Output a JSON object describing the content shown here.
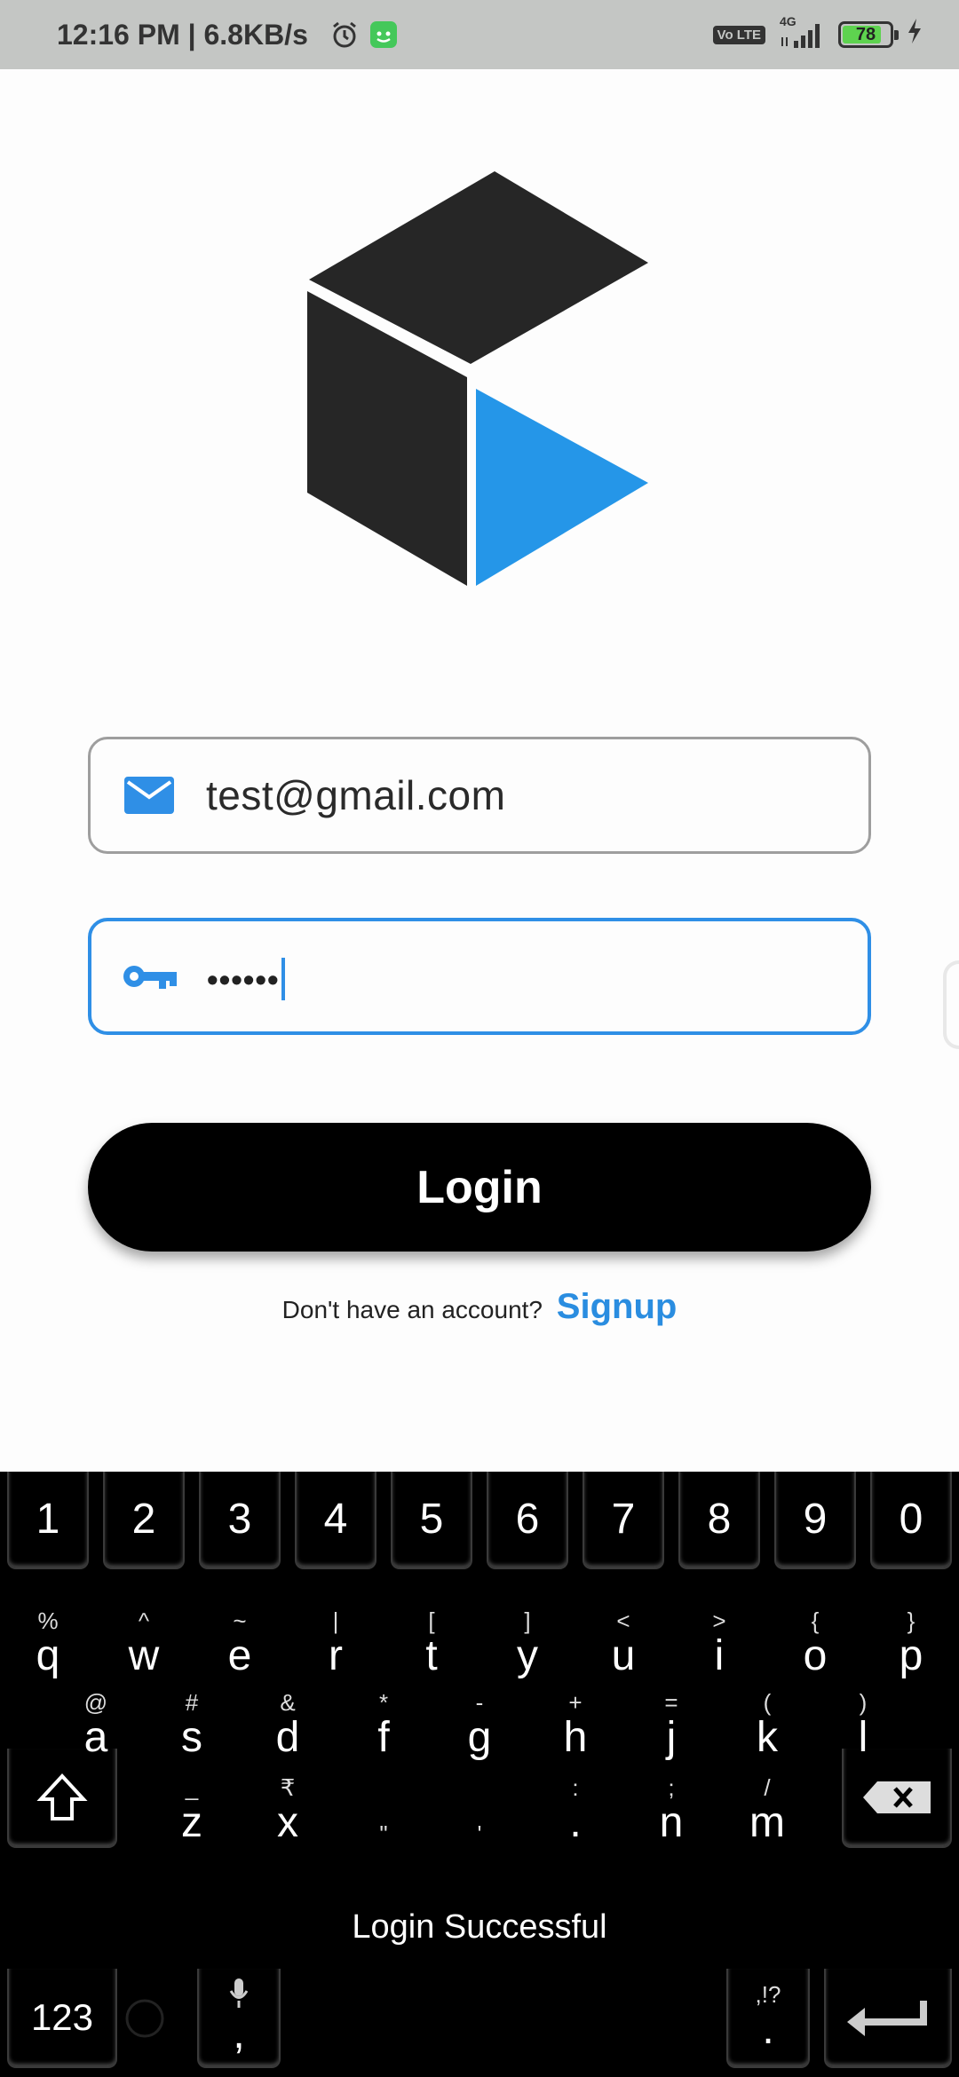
{
  "status_bar": {
    "time": "12:16 PM | 6.8KB/s",
    "network_label": "4G",
    "volte_label": "Vo LTE",
    "battery": "78",
    "icons": [
      "alarm-clock-icon",
      "app-notification-icon",
      "volte-icon",
      "signal-icon",
      "battery-icon",
      "charging-icon"
    ]
  },
  "form": {
    "email_value": "test@gmail.com",
    "password_value": "••••••",
    "login_label": "Login",
    "signup_prompt": "Don't have an account?",
    "signup_link": "Signup"
  },
  "colors": {
    "accent": "#2f8fe6",
    "logo_dark": "#262626",
    "logo_blue": "#2596e8"
  },
  "keyboard": {
    "numbers": [
      "1",
      "2",
      "3",
      "4",
      "5",
      "6",
      "7",
      "8",
      "9",
      "0"
    ],
    "row1": [
      {
        "main": "q",
        "sub": "%"
      },
      {
        "main": "w",
        "sub": "^"
      },
      {
        "main": "e",
        "sub": "~"
      },
      {
        "main": "r",
        "sub": "|"
      },
      {
        "main": "t",
        "sub": "["
      },
      {
        "main": "y",
        "sub": "]"
      },
      {
        "main": "u",
        "sub": "<"
      },
      {
        "main": "i",
        "sub": ">"
      },
      {
        "main": "o",
        "sub": "{"
      },
      {
        "main": "p",
        "sub": "}"
      }
    ],
    "row2": [
      {
        "main": "a",
        "sub": "@"
      },
      {
        "main": "s",
        "sub": "#"
      },
      {
        "main": "d",
        "sub": "&"
      },
      {
        "main": "f",
        "sub": "*"
      },
      {
        "main": "g",
        "sub": "-"
      },
      {
        "main": "h",
        "sub": "+"
      },
      {
        "main": "j",
        "sub": "="
      },
      {
        "main": "k",
        "sub": "("
      },
      {
        "main": "l",
        "sub": ")"
      }
    ],
    "row3": [
      {
        "main": "z",
        "sub": "_"
      },
      {
        "main": "x",
        "sub": "₹"
      },
      {
        "main": "",
        "sub": "\""
      },
      {
        "main": "",
        "sub": "'"
      },
      {
        "main": ".",
        "sub": ":"
      },
      {
        "main": "n",
        "sub": ";"
      },
      {
        "main": "m",
        "sub": "/"
      }
    ],
    "symbols_label": "123",
    "comma_label": ",",
    "period_label": ".",
    "period_sub": ",!?"
  },
  "toast": "Login Successful"
}
